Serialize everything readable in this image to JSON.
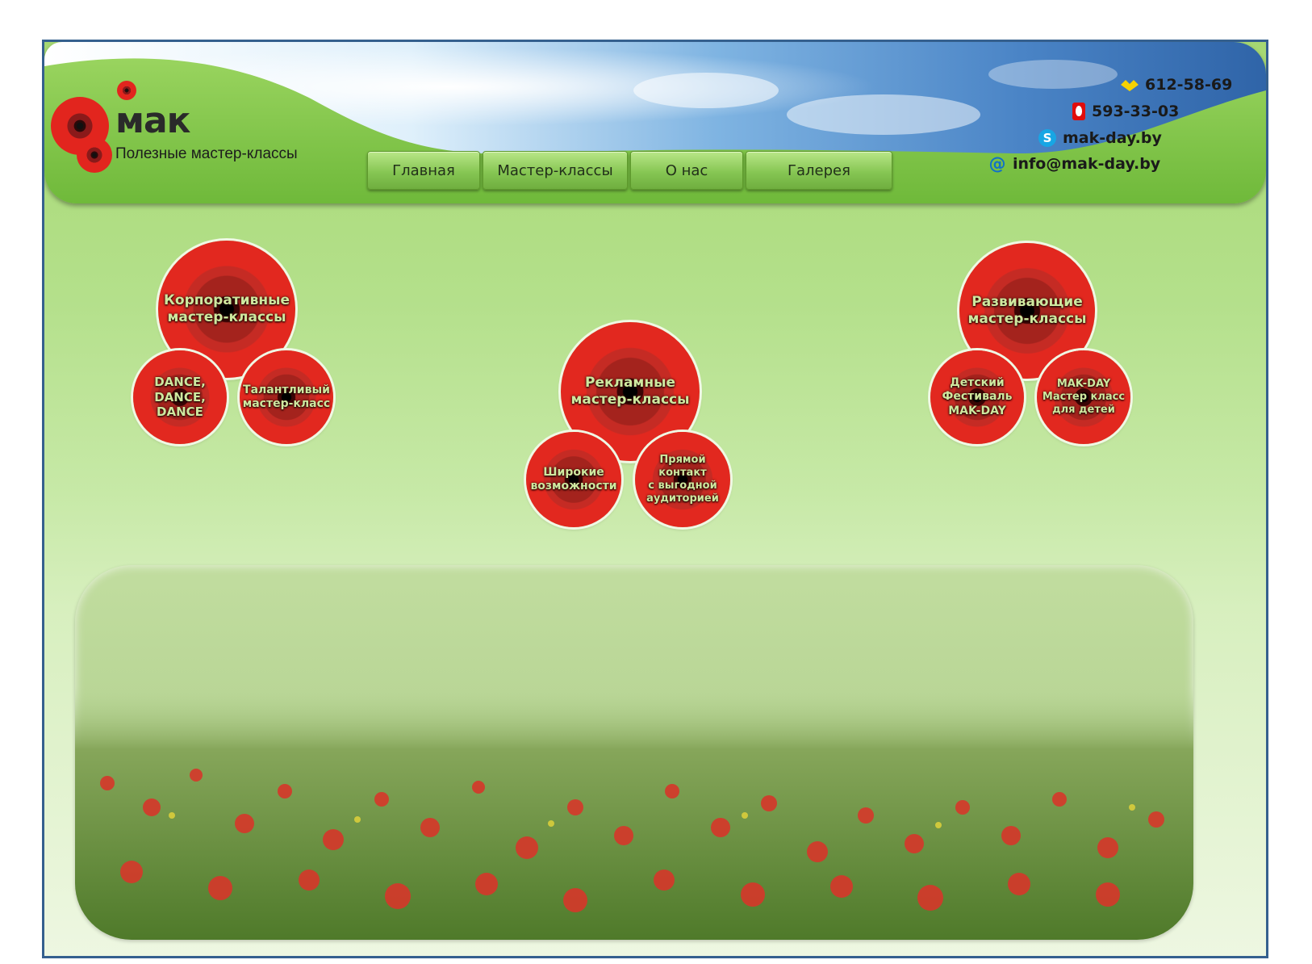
{
  "header": {
    "brand": "мак",
    "tagline": "Полезные мастер-классы"
  },
  "nav": [
    {
      "label": "Главная"
    },
    {
      "label": "Мастер-классы"
    },
    {
      "label": "О нас"
    },
    {
      "label": "Галерея"
    }
  ],
  "contacts": {
    "phone_life": "612-58-69",
    "phone_mts": "593-33-03",
    "skype": "mak-day.by",
    "email": "info@mak-day.by"
  },
  "flowers": {
    "corporate": "Корпоративные\nмастер-классы",
    "dance": "DANCE,\nDANCE,\nDANCE",
    "talent": "Талантливый\nмастер-класс",
    "advert": "Рекламные\nмастер-классы",
    "wide": "Широкие\nвозможности",
    "direct": "Прямой\nконтакт\nс выгодной\nаудиторией",
    "develop": "Развивающие\nмастер-классы",
    "festival": "Детский\nФестиваль\nMAK-DAY",
    "makday": "MAK-DAY\nМастер класс\nдля детей"
  }
}
